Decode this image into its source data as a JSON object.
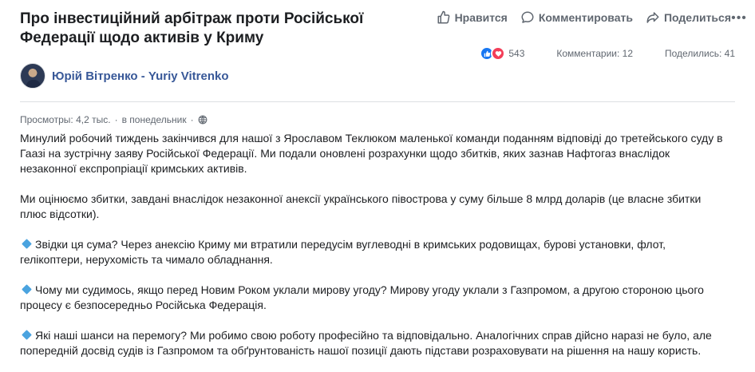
{
  "post": {
    "title": "Про інвестиційний арбітраж проти Російської Федерації щодо активів у Криму"
  },
  "actions": {
    "like": "Нравится",
    "comment": "Комментировать",
    "share": "Поделиться"
  },
  "stats": {
    "reactions_count": "543",
    "comments": "Комментарии: 12",
    "shares": "Поделились: 41"
  },
  "author": {
    "name": "Юрій Вітренко - Yuriy Vitrenko"
  },
  "meta": {
    "views": "Просмотры: 4,2 тыс.",
    "time": "в понедельник"
  },
  "paragraphs": [
    "Минулий робочий тиждень закінчився для нашої з Ярославом Теклюком маленької команди поданням відповіді до третейського суду в Гаазі на зустрічну заяву Російської Федерації. Ми подали оновлені розрахунки щодо збитків, яких зазнав Нафтогаз внаслідок незаконної експропріації кримських активів.",
    "Ми оцінюємо збитки, завдані внаслідок незаконної анексії українського півострова у суму більше 8 млрд доларів (це власне збитки плюс відсотки).",
    "Звідки ця сума? Через анексію Криму ми втратили передусім вуглеводні в кримських родовищах, бурові установки, флот, гелікоптери, нерухомість та чимало обладнання.",
    "Чому ми судимось, якщо перед Новим Роком уклали мирову угоду? Мирову угоду уклали з Газпромом, а другою стороною цього процесу є безпосередньо Російська Федерація.",
    "Які наші шанси на перемогу? Ми робимо свою роботу професійно та відповідально. Аналогічних справ дійсно наразі не було, але попередній досвід судів із Газпромом та обґрунтованість нашої позиції дають підстави розраховувати на рішення на нашу користь."
  ],
  "icons": {
    "like": "thumbs-up-icon",
    "comment": "comment-icon",
    "share": "share-arrow-icon",
    "more": "more-dots-icon",
    "privacy": "globe-icon",
    "bullet": "blue-diamond-icon"
  },
  "colors": {
    "like": "#1877f2",
    "love": "#f33e58",
    "author_link": "#385898",
    "bullet": "#4aa3df"
  }
}
